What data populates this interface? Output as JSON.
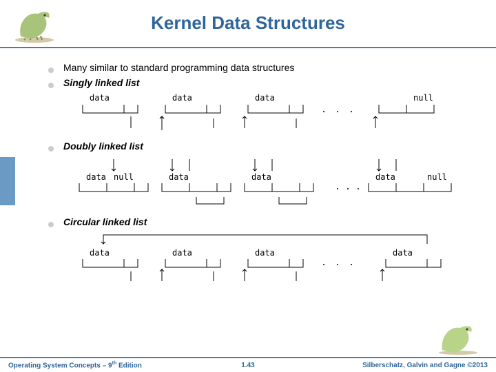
{
  "title": "Kernel Data Structures",
  "bullets": {
    "b1": "Many similar to standard programming data structures",
    "b2": "Singly linked list",
    "b3": "Doubly linked list",
    "b4": "Circular linked list"
  },
  "diagrams": {
    "singly": {
      "labels": [
        "data",
        "data",
        "data",
        "null"
      ]
    },
    "doubly": {
      "labels": [
        "data",
        "null",
        "data",
        "data",
        "data",
        "null"
      ]
    },
    "circular": {
      "labels": [
        "data",
        "data",
        "data",
        "data"
      ]
    }
  },
  "footer": {
    "left_prefix": "Operating System Concepts – 9",
    "left_suffix": " Edition",
    "left_sup": "th",
    "center": "1.43",
    "right": "Silberschatz, Galvin and Gagne ©2013"
  }
}
